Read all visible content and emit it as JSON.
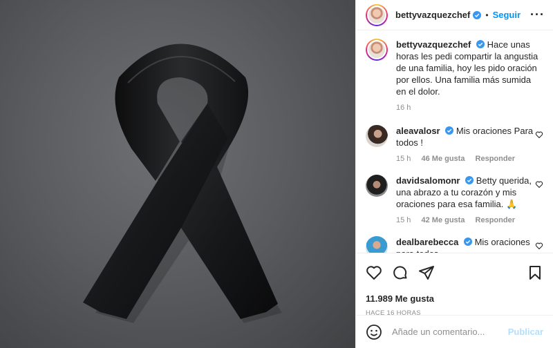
{
  "post": {
    "username": "bettyvazquezchef",
    "follow_label": "Seguir",
    "more_label": "···",
    "caption_text": "Hace unas horas les pedi compartir la angustia de una familia, hoy les pido oración por ellos. Una familia más sumida en el dolor.",
    "caption_time": "16 h"
  },
  "comments": [
    {
      "username": "aleavalosr",
      "text": "Mis oraciones Para todos !",
      "time": "15 h",
      "likes": "46 Me gusta",
      "reply": "Responder"
    },
    {
      "username": "davidsalomonr",
      "text": "Betty querida, una abrazo a tu corazón y mis oraciones para esa familia. 🙏",
      "time": "15 h",
      "likes": "42 Me gusta",
      "reply": "Responder"
    },
    {
      "username": "dealbarebecca",
      "text": "Mis oraciones para todos ."
    }
  ],
  "stats": {
    "likes": "11.989 Me gusta",
    "posted": "HACE 16 HORAS"
  },
  "composer": {
    "placeholder": "Añade un comentario...",
    "publish_label": "Publicar"
  },
  "colors": {
    "accent": "#0095f6",
    "verified": "#3897f0",
    "muted": "#8e8e8e",
    "publish_disabled": "#b2dffc"
  },
  "icons": [
    "verified-badge-icon",
    "more-icon",
    "heart-icon",
    "comment-icon",
    "share-icon",
    "bookmark-icon",
    "emoji-icon",
    "ribbon-image"
  ]
}
